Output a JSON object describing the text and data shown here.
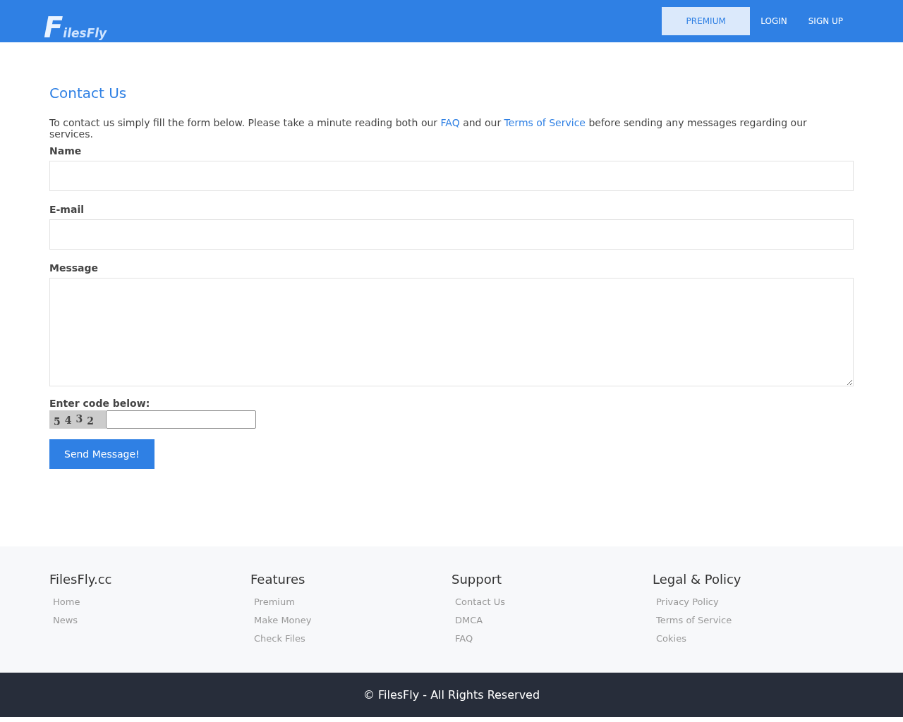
{
  "header": {
    "logo": "FilesFly",
    "nav": [
      {
        "label": "PREMIUM",
        "kind": "highlight"
      },
      {
        "label": "LOGIN",
        "kind": "plain"
      },
      {
        "label": "SIGN UP",
        "kind": "plain"
      }
    ]
  },
  "contact": {
    "title": "Contact Us",
    "intro": [
      {
        "text": "To contact us simply fill the form below. Please take a minute reading both our ",
        "kind": "text"
      },
      {
        "text": "FAQ",
        "kind": "link"
      },
      {
        "text": " and our ",
        "kind": "text"
      },
      {
        "text": "Terms of Service",
        "kind": "link"
      },
      {
        "text": " before sending any messages regarding our services.",
        "kind": "text"
      }
    ],
    "fields": [
      {
        "label": "Name",
        "kind": "input"
      },
      {
        "label": "E-mail",
        "kind": "input"
      },
      {
        "label": "Message",
        "kind": "textarea"
      }
    ],
    "captcha_label": "Enter code below:",
    "captcha": [
      "5",
      "4",
      "3",
      "2"
    ],
    "submit": "Send Message!"
  },
  "footer": {
    "columns": [
      {
        "title": "FilesFly.cc",
        "links": [
          "Home",
          "News"
        ]
      },
      {
        "title": "Features",
        "links": [
          "Premium",
          "Make Money",
          "Check Files"
        ]
      },
      {
        "title": "Support",
        "links": [
          "Contact Us",
          "DMCA",
          "FAQ"
        ]
      },
      {
        "title": "Legal & Policy",
        "links": [
          "Privacy Policy",
          "Terms of Service",
          "Cokies"
        ]
      }
    ],
    "copyright": "© FilesFly - All Rights Reserved"
  }
}
